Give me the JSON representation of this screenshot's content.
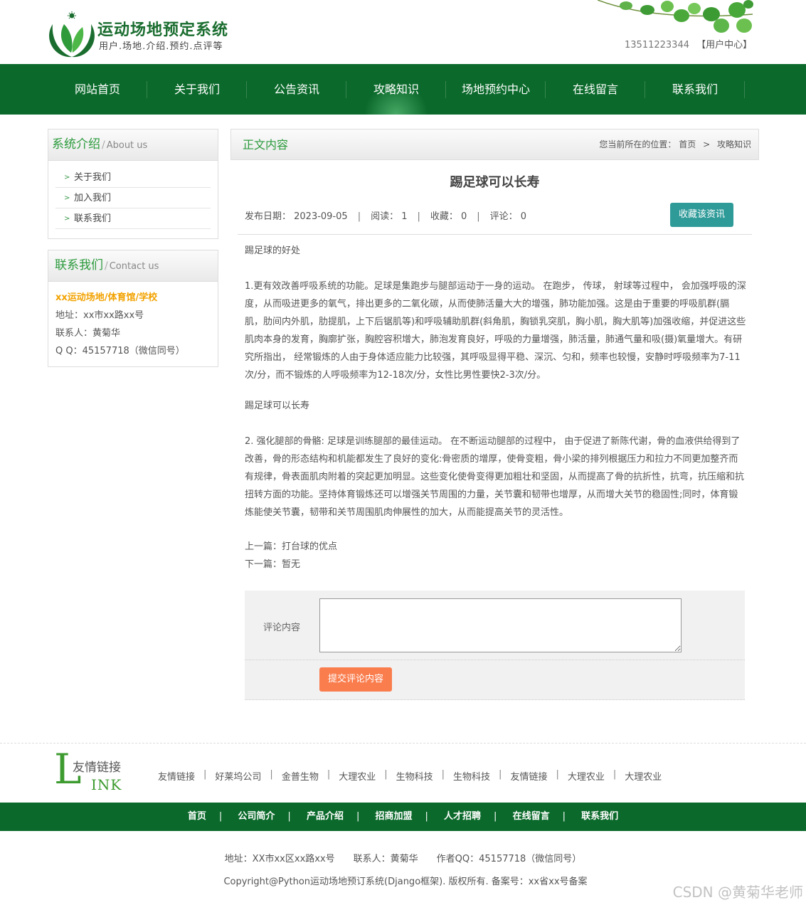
{
  "header": {
    "logo_title": "运动场地预定系统",
    "logo_subtitle": "用户.场地.介绍.预约.点评等",
    "phone": "13511223344",
    "user_center": "【用户中心】"
  },
  "nav": {
    "items": [
      "网站首页",
      "关于我们",
      "公告资讯",
      "攻略知识",
      "场地预约中心",
      "在线留言",
      "联系我们"
    ],
    "active_index": 3
  },
  "sidebar": {
    "about": {
      "title_cn": "系统介绍",
      "title_en": "About us",
      "items": [
        "关于我们",
        "加入我们",
        "联系我们"
      ]
    },
    "contact": {
      "title_cn": "联系我们",
      "title_en": "Contact us",
      "org": "xx运动场地/体育馆/学校",
      "address": "地址：xx市xx路xx号",
      "person": "联系人：黄菊华",
      "qq": "Q Q：45157718（微信同号）"
    }
  },
  "main": {
    "section_title": "正文内容",
    "breadcrumb": {
      "prefix": "您当前所在的位置：",
      "home": "首页",
      "sep": ">",
      "current": "攻略知识"
    },
    "article": {
      "title": "踢足球可以长寿",
      "date": "发布日期： 2023-09-05",
      "reads": "阅读：  1",
      "favorites": "收藏：  0",
      "comments": "评论：  0",
      "fav_button": "收藏该资讯",
      "paragraphs": [
        "踢足球的好处",
        "1.更有效改善呼吸系统的功能。足球是集跑步与腿部运动于一身的运动。 在跑步， 传球， 射球等过程中， 会加强呼吸的深度，从而吸进更多的氧气，排出更多的二氧化碳，从而使肺活量大大的增强，肺功能加强。这是由于重要的呼吸肌群(膈肌，肋间内外肌，肋提肌，上下后锯肌等)和呼吸辅助肌群(斜角肌，胸锁乳突肌，胸小肌，胸大肌等)加强收缩，并促进这些肌肉本身的发育，胸廓扩张，胸腔容积增大，肺泡发育良好，呼吸的力量增强，肺活量，肺通气量和吸(摄)氧量增大。有研究所指出， 经常锻炼的人由于身体适应能力比较强，其呼吸显得平稳、深沉、匀和，频率也较慢，安静时呼吸频率为7-11次/分，而不锻炼的人呼吸频率为12-18次/分，女性比男性要快2-3次/分。",
        "踢足球可以长寿",
        "2. 强化腿部的骨骼: 足球是训练腿部的最佳运动。 在不断运动腿部的过程中， 由于促进了新陈代谢，骨的血液供给得到了改善，骨的形态结构和机能都发生了良好的变化:骨密质的增厚，使骨变粗，骨小梁的排列根据压力和拉力不同更加整齐而有规律，骨表面肌肉附着的突起更加明显。这些变化使骨变得更加粗壮和坚固，从而提高了骨的抗折性，抗弯，抗压缩和抗扭转方面的功能。坚持体育锻炼还可以增强关节周围的力量，关节囊和韧带也增厚，从而增大关节的稳固性;同时，体育锻炼能使关节囊，韧带和关节周围肌肉伸展性的加大，从而能提高关节的灵活性。"
      ],
      "prev": "上一篇：打台球的优点",
      "next": "下一篇：暂无"
    },
    "comment": {
      "label": "评论内容",
      "value": "",
      "submit": "提交评论内容"
    }
  },
  "links": {
    "logo_letter_1": "L",
    "logo_cn": "友情链接",
    "logo_rest": "INK",
    "items": [
      "友情链接",
      "好莱坞公司",
      "金普生物",
      "大理农业",
      "生物科技",
      "生物科技",
      "友情链接",
      "大理农业",
      "大理农业"
    ]
  },
  "footer": {
    "nav": [
      "首页",
      "公司简介",
      "产品介绍",
      "招商加盟",
      "人才招聘",
      "在线留言",
      "联系我们"
    ],
    "address": "地址：XX市xx区xx路xx号",
    "contact": "联系人：黄菊华",
    "qq": "作者QQ：45157718（微信同号）",
    "copyright": "Copyright@Python运动场地预订系统(Django框架). 版权所有. 备案号：xx省xx号备案"
  },
  "watermark": "CSDN @黄菊华老师",
  "colors": {
    "brand_green": "#0b6a2b",
    "title_green": "#2b9a3c",
    "fav_teal": "#2f9b99",
    "submit_orange": "#fa7d4e",
    "org_yellow": "#f2a200"
  }
}
